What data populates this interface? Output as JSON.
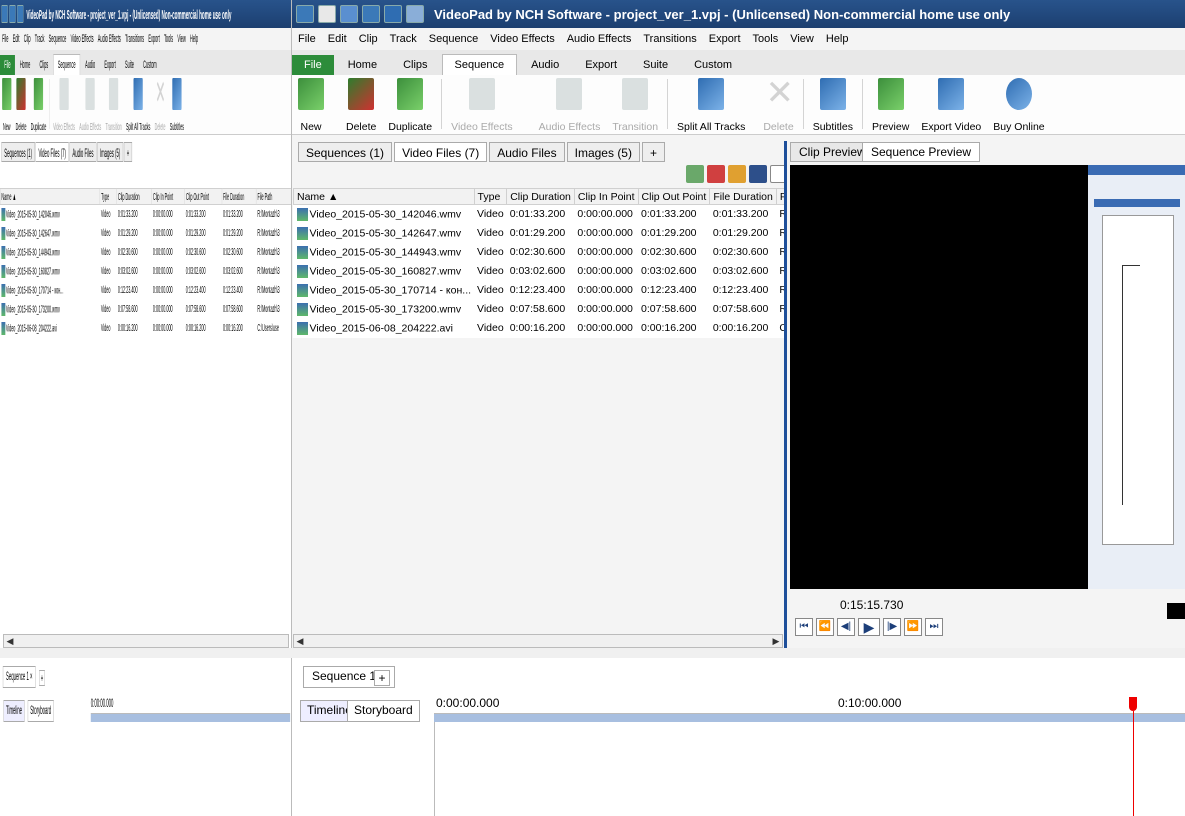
{
  "window": {
    "title": "VideoPad by NCH Software - project_ver_1.vpj - (Unlicensed) Non-commercial home use only"
  },
  "menu": [
    "File",
    "Edit",
    "Clip",
    "Track",
    "Sequence",
    "Video Effects",
    "Audio Effects",
    "Transitions",
    "Export",
    "Tools",
    "View",
    "Help"
  ],
  "ribbon_tabs": [
    "File",
    "Home",
    "Clips",
    "Sequence",
    "Audio",
    "Export",
    "Suite",
    "Custom"
  ],
  "active_ribbon_tab": "Sequence",
  "ribbon_buttons": [
    {
      "label": "New",
      "icon": "new-sequence-icon",
      "enabled": true
    },
    {
      "label": "Delete",
      "icon": "delete-sequence-icon",
      "enabled": true
    },
    {
      "label": "Duplicate",
      "icon": "duplicate-sequence-icon",
      "enabled": true
    },
    {
      "label": "Video Effects",
      "icon": "video-effects-icon",
      "enabled": false
    },
    {
      "label": "Audio Effects",
      "icon": "audio-effects-icon",
      "enabled": false
    },
    {
      "label": "Transition",
      "icon": "transition-icon",
      "enabled": false
    },
    {
      "label": "Split All Tracks",
      "icon": "split-tracks-icon",
      "enabled": true
    },
    {
      "label": "Delete",
      "icon": "delete-x-icon",
      "enabled": false
    },
    {
      "label": "Subtitles",
      "icon": "subtitles-icon",
      "enabled": true
    },
    {
      "label": "Preview",
      "icon": "preview-icon",
      "enabled": true
    },
    {
      "label": "Export Video",
      "icon": "export-video-icon",
      "enabled": true
    },
    {
      "label": "Buy Online",
      "icon": "buy-online-icon",
      "enabled": true
    }
  ],
  "bin_tabs": {
    "sequences": "Sequences",
    "sequences_count": "(1)",
    "video_files": "Video Files",
    "video_files_count": "(7)",
    "audio_files": "Audio Files",
    "images": "Images",
    "images_count": "(5)",
    "plus": "+"
  },
  "ghost_bin_tabs": {
    "sequences": "Sequences (1)",
    "video_files": "Video Files (7)",
    "audio_files": "Audio Files",
    "images": "Images (5)",
    "plus": "+"
  },
  "file_table": {
    "headers": [
      "Name",
      "Type",
      "Clip Duration",
      "Clip In Point",
      "Clip Out Point",
      "File Duration",
      "File Path"
    ],
    "sort_indicator": "▲",
    "rows": [
      [
        "Video_2015-05-30_142046.wmv",
        "Video",
        "0:01:33.200",
        "0:00:00.000",
        "0:01:33.200",
        "0:01:33.200",
        "R:\\Montazh\\3"
      ],
      [
        "Video_2015-05-30_142647.wmv",
        "Video",
        "0:01:29.200",
        "0:00:00.000",
        "0:01:29.200",
        "0:01:29.200",
        "R:\\Montazh\\3"
      ],
      [
        "Video_2015-05-30_144943.wmv",
        "Video",
        "0:02:30.600",
        "0:00:00.000",
        "0:02:30.600",
        "0:02:30.600",
        "R:\\Montazh\\3"
      ],
      [
        "Video_2015-05-30_160827.wmv",
        "Video",
        "0:03:02.600",
        "0:00:00.000",
        "0:03:02.600",
        "0:03:02.600",
        "R:\\Montazh\\3"
      ],
      [
        "Video_2015-05-30_170714 - кон...",
        "Video",
        "0:12:23.400",
        "0:00:00.000",
        "0:12:23.400",
        "0:12:23.400",
        "R:\\Montazh\\3"
      ],
      [
        "Video_2015-05-30_173200.wmv",
        "Video",
        "0:07:58.600",
        "0:00:00.000",
        "0:07:58.600",
        "0:07:58.600",
        "R:\\Montazh\\3"
      ],
      [
        "Video_2015-06-08_204222.avi",
        "Video",
        "0:00:16.200",
        "0:00:00.000",
        "0:00:16.200",
        "0:00:16.200",
        "C:\\Users\\use"
      ]
    ]
  },
  "preview": {
    "tabs": [
      "Clip Preview",
      "Sequence Preview"
    ],
    "active_tab": "Sequence Preview",
    "timecode": "0:15:15.730",
    "controls": [
      "⏮",
      "⏪",
      "◀|",
      "▶",
      "|▶",
      "⏩",
      "⏭"
    ]
  },
  "sequence_tabs": {
    "label": "Sequence 1",
    "close": "×",
    "plus": "+"
  },
  "timeline": {
    "buttons": [
      "Timeline",
      "Storyboard"
    ],
    "active": "Timeline",
    "ruler_start": "0:00:00.000",
    "ruler_mark": "0:10:00.000",
    "ghost_ruler_start": "0:00:00.000"
  },
  "colors": {
    "titlebar": "#1c3f70",
    "file_tab": "#2c8c3a",
    "splitter": "#1e4f9a",
    "playhead": "#e00000"
  }
}
